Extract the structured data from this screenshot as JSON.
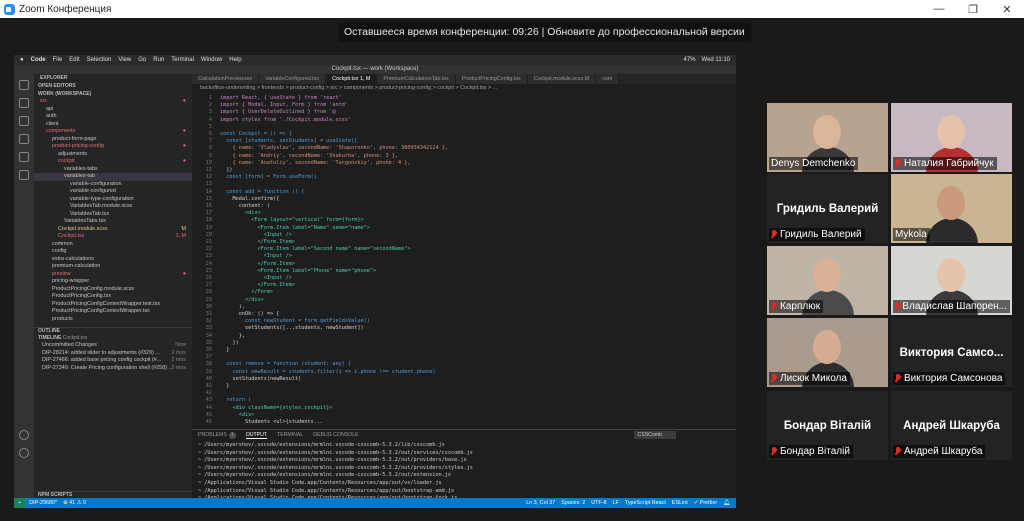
{
  "window": {
    "title": "Zoom Конференция",
    "controls": [
      "—",
      "❐",
      "✕"
    ]
  },
  "banner": {
    "text": "Оставшееся время конференции: 09:26 | Обновите до профессиональной версии"
  },
  "mac_menubar": {
    "items": [
      "Code",
      "File",
      "Edit",
      "Selection",
      "View",
      "Go",
      "Run",
      "Terminal",
      "Window",
      "Help"
    ],
    "battery": "47%",
    "clock": "Wed 11:10"
  },
  "vscode": {
    "window_title": "Cockpit.tsx — work (Workspace)",
    "explorer": {
      "title": "EXPLORER",
      "open_editors": "OPEN EDITORS",
      "workspace": "WORK (WORKSPACE)",
      "tree": [
        {
          "label": "src",
          "indent": 1,
          "color": "#e06c75",
          "status": "●"
        },
        {
          "label": "api",
          "indent": 2,
          "color": "#c5c5c5",
          "status": ""
        },
        {
          "label": "auth",
          "indent": 2,
          "color": "#c5c5c5",
          "status": ""
        },
        {
          "label": "client",
          "indent": 2,
          "color": "#c5c5c5",
          "status": ""
        },
        {
          "label": "components",
          "indent": 2,
          "color": "#e06c75",
          "status": "●"
        },
        {
          "label": "product-form-page",
          "indent": 3,
          "color": "#c5c5c5",
          "status": ""
        },
        {
          "label": "product-pricing-config",
          "indent": 3,
          "color": "#e06c75",
          "status": "●"
        },
        {
          "label": "adjustments",
          "indent": 4,
          "color": "#c5c5c5",
          "status": ""
        },
        {
          "label": "cockpit",
          "indent": 4,
          "color": "#e06c75",
          "status": "●"
        },
        {
          "label": "variables-tabs",
          "indent": 5,
          "color": "#c5c5c5",
          "status": ""
        },
        {
          "label": "variables-tab",
          "indent": 5,
          "color": "#c5c5c5",
          "status": "",
          "selected": true
        },
        {
          "label": "variable-configuration",
          "indent": 6,
          "color": "#c5c5c5",
          "status": ""
        },
        {
          "label": "variable-configured",
          "indent": 6,
          "color": "#c5c5c5",
          "status": ""
        },
        {
          "label": "variable-type-configuration",
          "indent": 6,
          "color": "#c5c5c5",
          "status": ""
        },
        {
          "label": "VariablesTab.module.scss",
          "indent": 6,
          "color": "#c5c5c5",
          "status": ""
        },
        {
          "label": "VariablesTab.tsx",
          "indent": 6,
          "color": "#c5c5c5",
          "status": ""
        },
        {
          "label": "VariablesTabs.tsx",
          "indent": 5,
          "color": "#c5c5c5",
          "status": ""
        },
        {
          "label": "Cockpit.module.scss",
          "indent": 4,
          "color": "#e2c08d",
          "status": "M"
        },
        {
          "label": "Cockpit.tsx",
          "indent": 4,
          "color": "#e06c75",
          "status": "1, M"
        },
        {
          "label": "common",
          "indent": 3,
          "color": "#c5c5c5",
          "status": ""
        },
        {
          "label": "config",
          "indent": 3,
          "color": "#c5c5c5",
          "status": ""
        },
        {
          "label": "extra-calculations",
          "indent": 3,
          "color": "#c5c5c5",
          "status": ""
        },
        {
          "label": "premium-calculation",
          "indent": 3,
          "color": "#c5c5c5",
          "status": ""
        },
        {
          "label": "preview",
          "indent": 3,
          "color": "#e06c75",
          "status": "●"
        },
        {
          "label": "pricing-wrapper",
          "indent": 3,
          "color": "#c5c5c5",
          "status": ""
        },
        {
          "label": "ProductPricingConfig.module.scss",
          "indent": 3,
          "color": "#c5c5c5",
          "status": ""
        },
        {
          "label": "ProductPricingConfig.tsx",
          "indent": 3,
          "color": "#c5c5c5",
          "status": ""
        },
        {
          "label": "ProductPricingConfigContextWrapper.test.tsx",
          "indent": 3,
          "color": "#c5c5c5",
          "status": ""
        },
        {
          "label": "ProductPricingConfigContextWrapper.tsx",
          "indent": 3,
          "color": "#c5c5c5",
          "status": ""
        },
        {
          "label": "products",
          "indent": 3,
          "color": "#c5c5c5",
          "status": ""
        }
      ],
      "outline": "OUTLINE",
      "timeline": "TIMELINE",
      "timeline_file": "Cockpit.tsx",
      "timeline_items": [
        {
          "label": "Uncommitted Changes",
          "time": "Now"
        },
        {
          "label": "DIP-28214: added slider to adjustments (#329) ...",
          "time": "2 mos"
        },
        {
          "label": "DIP-27466: added base pricing config cockpit (#...",
          "time": "2 mos"
        },
        {
          "label": "DIP-27349: Create Pricing configuration shell (#258) ...",
          "time": "2 mos"
        }
      ],
      "npm_scripts": "NPM SCRIPTS"
    },
    "tabs": [
      {
        "label": "CalculationPreview.tsx",
        "active": false
      },
      {
        "label": "VariableConfigured.tsx",
        "active": false
      },
      {
        "label": "Cockpit.tsx 1, M",
        "active": true
      },
      {
        "label": "PremiumCalculationTab.tsx",
        "active": false
      },
      {
        "label": "ProductPricingConfig.tsx",
        "active": false
      },
      {
        "label": "Cockpit.module.scss M",
        "active": false
      },
      {
        "label": "com",
        "active": false
      }
    ],
    "breadcrumb": "backoffice-underwriting > frontends > product-config > src > components > product-pricing-config > cockpit > Cockpit.tsx > ...",
    "code_lines": [
      {
        "n": "1",
        "t": "import React, { useState } from 'react'"
      },
      {
        "n": "2",
        "t": "import { Modal, Input, Form } from 'antd'"
      },
      {
        "n": "3",
        "t": "import { UserDeleteOutlined } from '@"
      },
      {
        "n": "4",
        "t": "import styles from './Cockpit.module.scss'"
      },
      {
        "n": "5",
        "t": ""
      },
      {
        "n": "6",
        "t": "const Cockpit = () => {"
      },
      {
        "n": "7",
        "t": "  const [students, setStudents] = useState(["
      },
      {
        "n": "8",
        "t": "    { name: 'Vladyslav', secondName: 'Shaporenko', phone: 380934342124 },"
      },
      {
        "n": "9",
        "t": "    { name: 'Andriy', secondName: 'Shakurba', phone: 3 },"
      },
      {
        "n": "10",
        "t": "    { name: 'Anatoliy', secondName: 'Targonskiy', phone: 4 },"
      },
      {
        "n": "11",
        "t": "  ])"
      },
      {
        "n": "12",
        "t": "  const [form] = Form.useForm()"
      },
      {
        "n": "13",
        "t": ""
      },
      {
        "n": "14",
        "t": "  const add = function () {"
      },
      {
        "n": "15",
        "t": "    Modal.confirm({"
      },
      {
        "n": "16",
        "t": "      content: ("
      },
      {
        "n": "17",
        "t": "        <div>"
      },
      {
        "n": "18",
        "t": "          <Form layout=\"vertical\" form={form}>"
      },
      {
        "n": "19",
        "t": "            <Form.Item label=\"Name\" name=\"name\">"
      },
      {
        "n": "20",
        "t": "              <Input />"
      },
      {
        "n": "21",
        "t": "            </Form.Item>"
      },
      {
        "n": "22",
        "t": "            <Form.Item label=\"Second name\" name=\"secondName\">"
      },
      {
        "n": "23",
        "t": "              <Input />"
      },
      {
        "n": "24",
        "t": "            </Form.Item>"
      },
      {
        "n": "25",
        "t": "            <Form.Item label=\"Phone\" name=\"phone\">"
      },
      {
        "n": "26",
        "t": "              <Input />"
      },
      {
        "n": "27",
        "t": "            </Form.Item>"
      },
      {
        "n": "28",
        "t": "          </Form>"
      },
      {
        "n": "29",
        "t": "        </div>"
      },
      {
        "n": "30",
        "t": "      ),"
      },
      {
        "n": "31",
        "t": "      onOk: () => {"
      },
      {
        "n": "32",
        "t": "        const newStudent = form.getFieldsValue()"
      },
      {
        "n": "33",
        "t": "        setStudents([...students, newStudent])"
      },
      {
        "n": "34",
        "t": "      },"
      },
      {
        "n": "35",
        "t": "    })"
      },
      {
        "n": "36",
        "t": "  }"
      },
      {
        "n": "37",
        "t": ""
      },
      {
        "n": "38",
        "t": "  const remove = function (student: any) {"
      },
      {
        "n": "39",
        "t": "    const newResult = students.filter(i => i.phone !== student.phone)"
      },
      {
        "n": "40",
        "t": "    setStudents(newResult)"
      },
      {
        "n": "41",
        "t": "  }"
      },
      {
        "n": "42",
        "t": ""
      },
      {
        "n": "43",
        "t": "  return ("
      },
      {
        "n": "44",
        "t": "    <div className={styles.cockpit}>"
      },
      {
        "n": "45",
        "t": "      <div>"
      },
      {
        "n": "46",
        "t": "        Students <ul>{students..."
      }
    ],
    "panel": {
      "tabs": [
        "PROBLEMS",
        "1",
        "OUTPUT",
        "TERMINAL",
        "DEBUG CONSOLE"
      ],
      "select": "CSSComb",
      "lines": [
        "~ /Users/myershov/.vscode/extensions/mrmlnc.vscode-csscomb-5.3.2/lib/csscomb.js",
        "~ /Users/myershov/.vscode/extensions/mrmlnc.vscode-csscomb-5.3.2/out/services/csscomb.js",
        "~ /Users/myershov/.vscode/extensions/mrmlnc.vscode-csscomb-5.3.2/out/providers/base.js",
        "~ /Users/myershov/.vscode/extensions/mrmlnc.vscode-csscomb-5.3.2/out/providers/styles.js",
        "~ /Users/myershov/.vscode/extensions/mrmlnc.vscode-csscomb-5.3.2/out/extension.js",
        "~ /Applications/Visual Studio Code.app/Contents/Resources/app/out/vs/loader.js",
        "~ /Applications/Visual Studio Code.app/Contents/Resources/app/out/bootstrap-amd.js",
        "~ /Applications/Visual Studio Code.app/Contents/Resources/app/out/bootstrap-fork.js"
      ]
    },
    "statusbar": {
      "branch": "DIP-29680*",
      "problems": "⊗ 41 ⚠ 0",
      "position": "Ln 3, Col 37",
      "spaces": "Spaces: 2",
      "encoding": "UTF-8",
      "eol": "LF",
      "language": "TypeScript React",
      "eslint": "ESLint",
      "prettier": "✓ Prettier"
    }
  },
  "participants": [
    {
      "name": "Denys Demchenko",
      "video": true,
      "muted": false,
      "speaking": false,
      "bg": "#b8a48e",
      "skin": "#d9b69a",
      "shirt": "#3a3a3a"
    },
    {
      "name": "Наталия Габрийчук",
      "video": true,
      "muted": true,
      "speaking": false,
      "bg": "#c7b8c2",
      "skin": "#e6c2ab",
      "shirt": "#b5312f"
    },
    {
      "name": "Гридиль Валерий",
      "video": false,
      "muted": true,
      "speaking": false,
      "big": "Гридиль Валерий"
    },
    {
      "name": "Mykola",
      "video": true,
      "muted": false,
      "speaking": true,
      "bg": "#c9b591",
      "skin": "#c99a7c",
      "shirt": "#2b2b2b"
    },
    {
      "name": "Карплюк",
      "video": true,
      "muted": true,
      "speaking": false,
      "bg": "#bfb4a6",
      "skin": "#d8b196",
      "shirt": "#4a4a4a"
    },
    {
      "name": "Владислав Шапорен...",
      "video": true,
      "muted": true,
      "speaking": false,
      "bg": "#d8d6d2",
      "skin": "#e5c3ad",
      "shirt": "#3b3b3b"
    },
    {
      "name": "Лисюк Микола",
      "video": true,
      "muted": true,
      "speaking": false,
      "bg": "#a89a8c",
      "skin": "#d6ad93",
      "shirt": "#2e2e2e"
    },
    {
      "name": "Виктория Самсонова",
      "video": false,
      "muted": true,
      "speaking": false,
      "big": "Виктория  Самсо..."
    },
    {
      "name": "Бондар Віталій",
      "video": false,
      "muted": true,
      "speaking": false,
      "big": "Бондар Віталій"
    },
    {
      "name": "Андрей Шкаруба",
      "video": false,
      "muted": true,
      "speaking": false,
      "big": "Андрей Шкаруба"
    }
  ]
}
